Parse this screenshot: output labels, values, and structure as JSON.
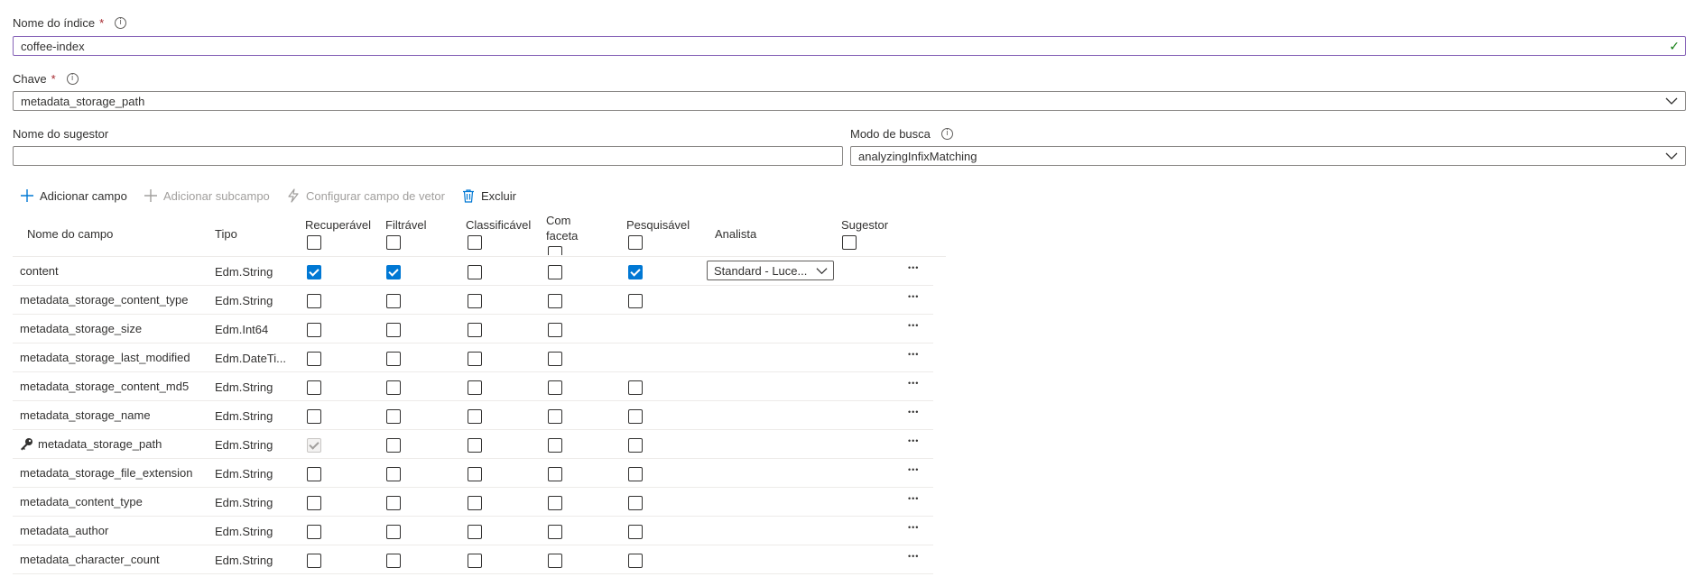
{
  "form": {
    "index_name": {
      "label": "Nome do índice",
      "required": "*",
      "value": "coffee-index"
    },
    "key": {
      "label": "Chave",
      "required": "*",
      "value": "metadata_storage_path"
    },
    "suggester_name": {
      "label": "Nome do sugestor",
      "value": ""
    },
    "search_mode": {
      "label": "Modo de busca",
      "value": "analyzingInfixMatching"
    }
  },
  "toolbar": {
    "add_field": "Adicionar campo",
    "add_subfield": "Adicionar subcampo",
    "configure_vector": "Configurar campo de vetor",
    "delete": "Excluir"
  },
  "table": {
    "headers": {
      "field_name": "Nome do campo",
      "type": "Tipo",
      "retrievable": "Recuperável",
      "filterable": "Filtrável",
      "sortable": "Classificável",
      "facetable_1": "Com",
      "facetable_2": "faceta",
      "searchable": "Pesquisável",
      "analyzer": "Analista",
      "suggester": "Sugestor"
    },
    "header_checks": {
      "retrievable": false,
      "filterable": false,
      "sortable": false,
      "facetable": false,
      "searchable": false,
      "suggester": false
    },
    "rows": [
      {
        "name": "content",
        "type": "Edm.String",
        "retrievable": "checked",
        "filterable": "checked",
        "sortable": "unchecked",
        "facetable": "unchecked",
        "searchable": "checked",
        "analyzer": "Standard - Luce...",
        "is_key": false
      },
      {
        "name": "metadata_storage_content_type",
        "type": "Edm.String",
        "retrievable": "unchecked",
        "filterable": "unchecked",
        "sortable": "unchecked",
        "facetable": "unchecked",
        "searchable": "unchecked",
        "analyzer": "",
        "is_key": false
      },
      {
        "name": "metadata_storage_size",
        "type": "Edm.Int64",
        "retrievable": "unchecked",
        "filterable": "unchecked",
        "sortable": "unchecked",
        "facetable": "unchecked",
        "searchable": "none",
        "analyzer": "",
        "is_key": false
      },
      {
        "name": "metadata_storage_last_modified",
        "type": "Edm.DateTi...",
        "retrievable": "unchecked",
        "filterable": "unchecked",
        "sortable": "unchecked",
        "facetable": "unchecked",
        "searchable": "none",
        "analyzer": "",
        "is_key": false
      },
      {
        "name": "metadata_storage_content_md5",
        "type": "Edm.String",
        "retrievable": "unchecked",
        "filterable": "unchecked",
        "sortable": "unchecked",
        "facetable": "unchecked",
        "searchable": "unchecked",
        "analyzer": "",
        "is_key": false
      },
      {
        "name": "metadata_storage_name",
        "type": "Edm.String",
        "retrievable": "unchecked",
        "filterable": "unchecked",
        "sortable": "unchecked",
        "facetable": "unchecked",
        "searchable": "unchecked",
        "analyzer": "",
        "is_key": false
      },
      {
        "name": "metadata_storage_path",
        "type": "Edm.String",
        "retrievable": "disabled",
        "filterable": "unchecked",
        "sortable": "unchecked",
        "facetable": "unchecked",
        "searchable": "unchecked",
        "analyzer": "",
        "is_key": true
      },
      {
        "name": "metadata_storage_file_extension",
        "type": "Edm.String",
        "retrievable": "unchecked",
        "filterable": "unchecked",
        "sortable": "unchecked",
        "facetable": "unchecked",
        "searchable": "unchecked",
        "analyzer": "",
        "is_key": false
      },
      {
        "name": "metadata_content_type",
        "type": "Edm.String",
        "retrievable": "unchecked",
        "filterable": "unchecked",
        "sortable": "unchecked",
        "facetable": "unchecked",
        "searchable": "unchecked",
        "analyzer": "",
        "is_key": false
      },
      {
        "name": "metadata_author",
        "type": "Edm.String",
        "retrievable": "unchecked",
        "filterable": "unchecked",
        "sortable": "unchecked",
        "facetable": "unchecked",
        "searchable": "unchecked",
        "analyzer": "",
        "is_key": false
      },
      {
        "name": "metadata_character_count",
        "type": "Edm.String",
        "retrievable": "unchecked",
        "filterable": "unchecked",
        "sortable": "unchecked",
        "facetable": "unchecked",
        "searchable": "unchecked",
        "analyzer": "",
        "is_key": false
      }
    ]
  },
  "icons": {
    "info": "info-icon",
    "valid": "checkmark-icon",
    "dropdown": "chevron-down-icon",
    "add": "plus-icon",
    "vector": "lightning-icon",
    "delete": "trash-icon",
    "key": "key-icon",
    "more": "more-icon"
  },
  "colors": {
    "accent": "#0078d4",
    "valid_border": "#8764b8",
    "valid_check": "#107c10",
    "required": "#a4262c"
  }
}
